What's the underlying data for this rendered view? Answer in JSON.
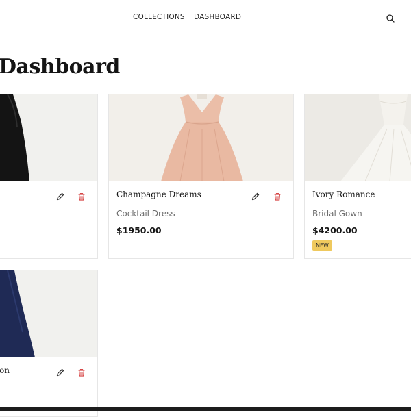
{
  "nav": {
    "links": [
      "COLLECTIONS",
      "DASHBOARD"
    ],
    "search_icon": "search-icon"
  },
  "page": {
    "title": "Dashboard"
  },
  "products": [
    {
      "name": "",
      "image": "black-gown-photo",
      "dress_color": "#141414"
    },
    {
      "name": "Champagne Dreams",
      "category": "Cocktail Dress",
      "price": "$1950.00",
      "image": "blush-cocktail-dress-photo",
      "dress_color": "#e9b9a2"
    },
    {
      "name": "Ivory Romance",
      "category": "Bridal Gown",
      "price": "$4200.00",
      "badge": "NEW",
      "image": "white-bridal-gown-photo",
      "dress_color": "#f3f1ec"
    },
    {
      "name": "on",
      "image": "navy-gown-photo",
      "dress_color": "#1f2a55"
    }
  ],
  "colors": {
    "edit_icon": "#333333",
    "delete_icon": "#d64545",
    "badge_bg": "#efc95e",
    "photo_bg": "#f1f1ee"
  }
}
